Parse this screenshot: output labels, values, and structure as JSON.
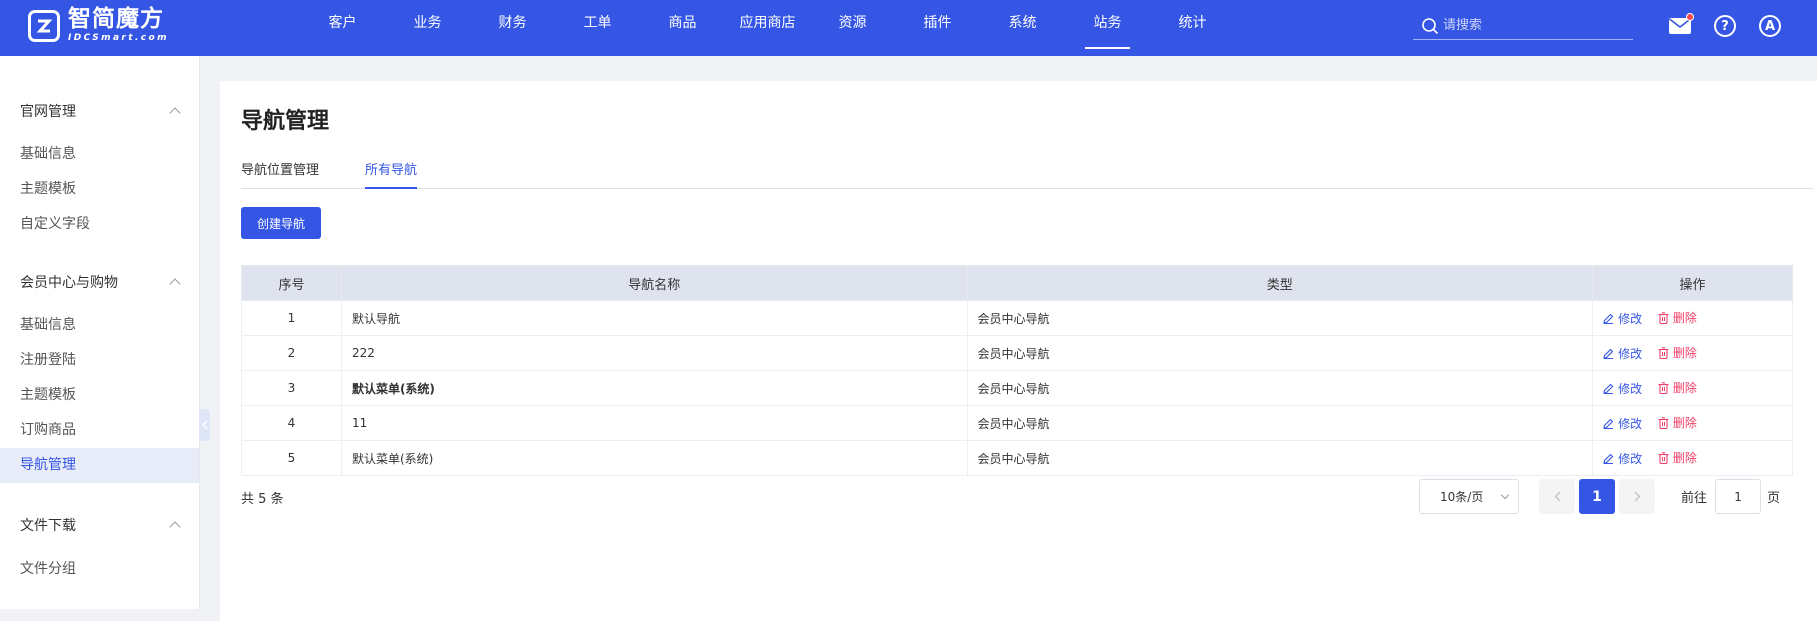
{
  "brand": {
    "name_cn": "智简魔方",
    "name_en": "IDCSmart.com"
  },
  "nav": [
    {
      "label": "客户",
      "active": false
    },
    {
      "label": "业务",
      "active": false
    },
    {
      "label": "财务",
      "active": false
    },
    {
      "label": "工单",
      "active": false
    },
    {
      "label": "商品",
      "active": false
    },
    {
      "label": "应用商店",
      "active": false
    },
    {
      "label": "资源",
      "active": false
    },
    {
      "label": "插件",
      "active": false
    },
    {
      "label": "系统",
      "active": false
    },
    {
      "label": "站务",
      "active": true
    },
    {
      "label": "统计",
      "active": false
    }
  ],
  "search": {
    "placeholder": "请搜索"
  },
  "header_icons": {
    "mail": "mail-icon",
    "help": "?",
    "avatar": "A",
    "accent": "#3556e4",
    "notify_color": "#f5484f"
  },
  "sidebar": {
    "groups": [
      {
        "label": "官网管理",
        "items": [
          "基础信息",
          "主题模板",
          "自定义字段"
        ]
      },
      {
        "label": "会员中心与购物",
        "items": [
          "基础信息",
          "注册登陆",
          "主题模板",
          "订购商品",
          "导航管理"
        ]
      },
      {
        "label": "文件下载",
        "items": [
          "文件分组"
        ]
      }
    ],
    "active_item": "导航管理"
  },
  "page": {
    "title": "导航管理",
    "tabs": [
      "导航位置管理",
      "所有导航"
    ],
    "active_tab": "所有导航",
    "create_button": "创建导航"
  },
  "table": {
    "headers": [
      "序号",
      "导航名称",
      "类型",
      "操作"
    ],
    "rows": [
      {
        "id": "1",
        "name": "默认导航",
        "type": "会员中心导航",
        "link": false
      },
      {
        "id": "2",
        "name": "222",
        "type": "会员中心导航",
        "link": false
      },
      {
        "id": "3",
        "name": "默认菜单(系统)",
        "type": "会员中心导航",
        "link": true
      },
      {
        "id": "4",
        "name": "11",
        "type": "会员中心导航",
        "link": false
      },
      {
        "id": "5",
        "name": "默认菜单(系统)",
        "type": "会员中心导航",
        "link": false
      }
    ],
    "edit_label": "修改",
    "delete_label": "删除"
  },
  "pagination": {
    "total_text": "共 5 条",
    "page_size": "10条/页",
    "current_page": "1",
    "goto_label": "前往",
    "goto_value": "1",
    "page_suffix": "页"
  }
}
